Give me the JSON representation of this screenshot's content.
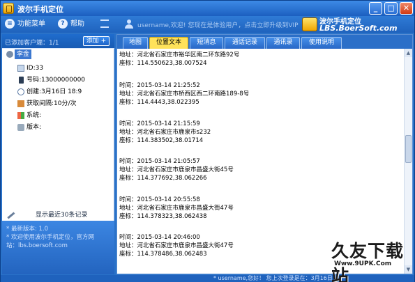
{
  "window": {
    "title": "波尔手机定位",
    "min": "_",
    "max": "□",
    "close": "✕"
  },
  "toolbar": {
    "menu_label": "功能菜单",
    "help_label": "帮助",
    "notice": "username,欢迎! 您现在是体验用户，点击立即升级到VIP",
    "logo_line1": "波尔手机定位",
    "logo_line2": "LBS.BoerSoft.com"
  },
  "left": {
    "clients_label": "已添加客户端：1/1",
    "add_button": "添加 +",
    "tree": {
      "name": "李金",
      "id": "ID:33",
      "phone": "号码:13000000000",
      "created": "创建:3月16日 18:9",
      "interval": "获取间隔:10分/次",
      "system": "系统:",
      "version": "版本:"
    },
    "recent_label": "显示最近30条记录",
    "info_lines": [
      "* 最新版本: 1.0",
      "* 欢迎使用波尔手机定位，官方网",
      "站：lbs.boersoft.com"
    ]
  },
  "tabs": [
    "地图",
    "位置文本",
    "短消息",
    "通话记录",
    "通讯录",
    "使用说明"
  ],
  "active_tab": "位置文本",
  "records": [
    {
      "addr": "地址：河北省石家庄市裕华区南二环东路92号",
      "coord": "座标：114.550623,38.007524"
    },
    {
      "time": "时间：2015-03-14 21:25:52",
      "addr": "地址：河北省石家庄市桥西区西二环南路189-8号",
      "coord": "座标：114.4443,38.022395"
    },
    {
      "time": "时间：2015-03-14 21:15:59",
      "addr": "地址：河北省石家庄市鹿泉市s232",
      "coord": "座标：114.383502,38.01714"
    },
    {
      "time": "时间：2015-03-14 21:05:57",
      "addr": "地址：河北省石家庄市鹿泉市昌盛大街45号",
      "coord": "座标：114.377692,38.062266"
    },
    {
      "time": "时间：2015-03-14 20:55:58",
      "addr": "地址：河北省石家庄市鹿泉市昌盛大街47号",
      "coord": "座标：114.378323,38.062438"
    },
    {
      "time": "时间：2015-03-14 20:46:00",
      "addr": "地址：河北省石家庄市鹿泉市昌盛大街47号",
      "coord": "座标：114.378486,38.062483"
    }
  ],
  "status": "* username,您好！ 您上次登录是在：3月16日",
  "watermark": {
    "main": "久友下载站",
    "url": "Www.9UPK.Com"
  }
}
